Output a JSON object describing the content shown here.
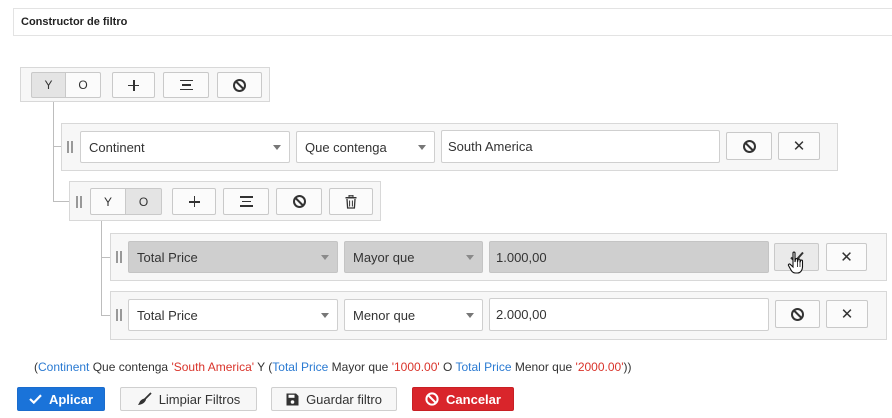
{
  "panel": {
    "title": "Constructor de filtro"
  },
  "root_group": {
    "and_label": "Y",
    "or_label": "O",
    "active": "and",
    "add_rule_icon": "plus-icon",
    "add_group_icon": "align-lines-icon",
    "disable_icon": "ban-icon"
  },
  "rule_continent": {
    "field": "Continent",
    "operator": "Que contenga",
    "value": "South America",
    "disable_icon": "ban-icon",
    "remove_icon": "close-icon"
  },
  "nested_group": {
    "and_label": "Y",
    "or_label": "O",
    "active": "or",
    "add_rule_icon": "plus-icon",
    "add_group_icon": "align-lines-icon",
    "disable_icon": "ban-icon",
    "delete_icon": "trash-icon"
  },
  "rule_price_gt": {
    "field": "Total Price",
    "operator": "Mayor que",
    "value": "1.000,00",
    "disabled": true,
    "enable_icon": "check-icon",
    "remove_icon": "close-icon"
  },
  "rule_price_lt": {
    "field": "Total Price",
    "operator": "Menor que",
    "value": "2.000,00",
    "disable_icon": "ban-icon",
    "remove_icon": "close-icon"
  },
  "summary": {
    "open_paren": "(",
    "f1": "Continent",
    "op1": " Que contenga ",
    "v1": "'South America'",
    "join1": " Y (",
    "f2": "Total Price",
    "op2": " Mayor que ",
    "v2": "'1000.00'",
    "join2": " O ",
    "f3": "Total Price",
    "op3": " Menor que ",
    "v3": "'2000.00'",
    "close_paren": "))"
  },
  "actions": {
    "apply": "Aplicar",
    "clear": "Limpiar Filtros",
    "save": "Guardar filtro",
    "cancel": "Cancelar"
  },
  "colors": {
    "primary": "#1a73d9",
    "danger": "#d9252b",
    "summary_field": "#2a7ad2",
    "summary_value": "#d9342b"
  }
}
